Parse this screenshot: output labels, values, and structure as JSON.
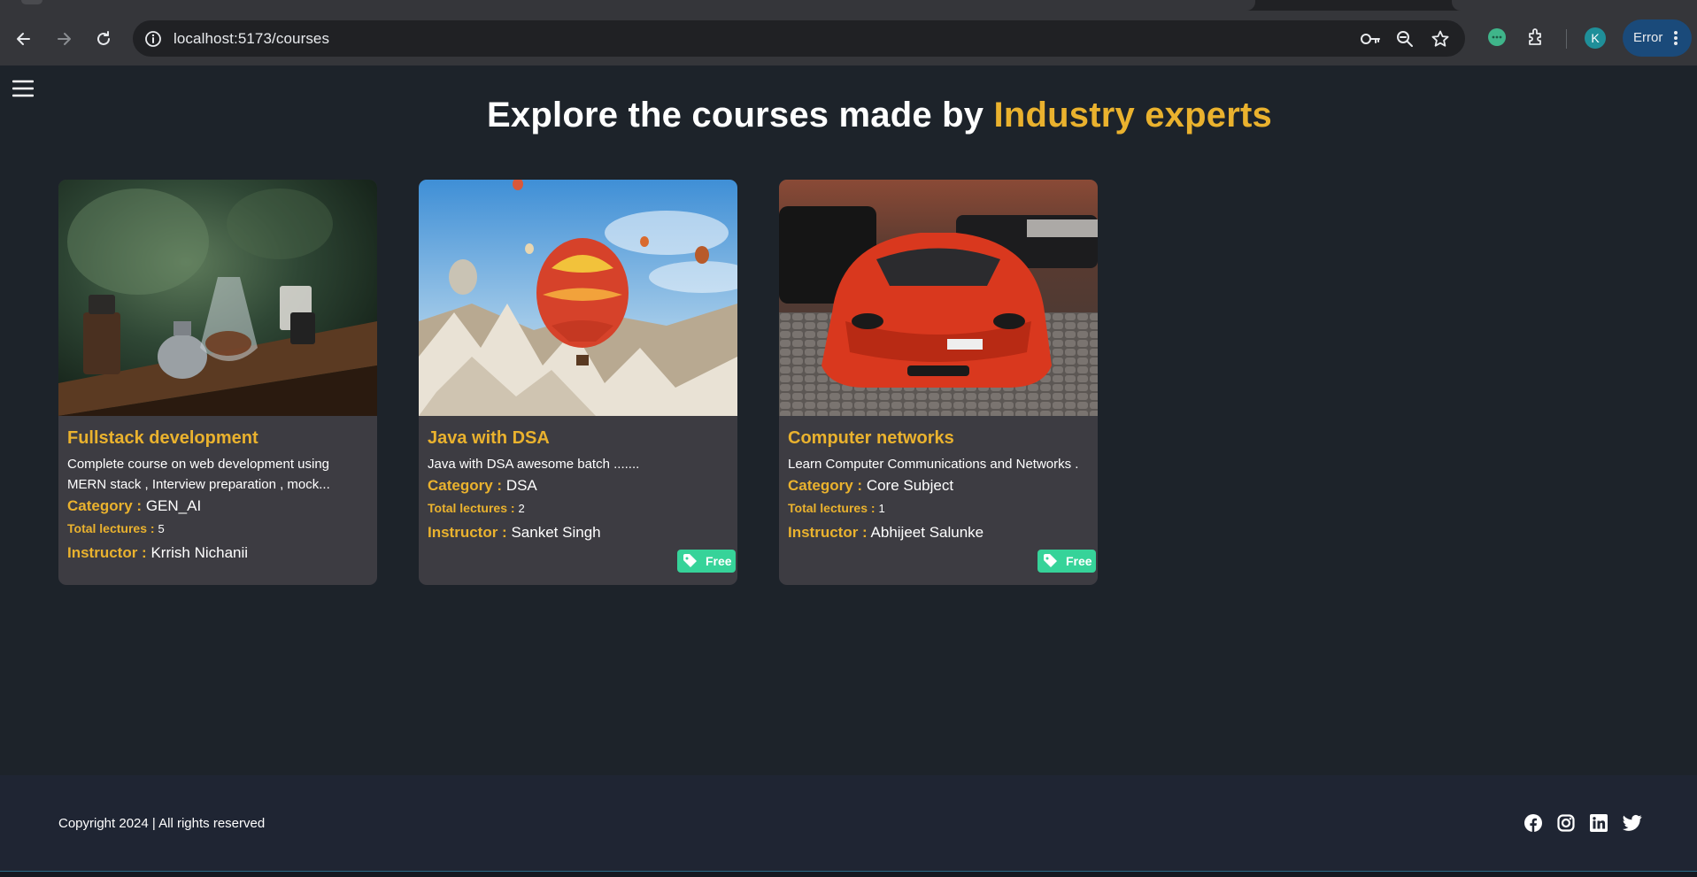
{
  "browser": {
    "url": "localhost:5173/courses",
    "profile_initial": "K",
    "error_label": "Error"
  },
  "page": {
    "title_prefix": "Explore the courses made by ",
    "title_accent": "Industry experts"
  },
  "courses": [
    {
      "title": "Fullstack development",
      "description": "Complete course on web development using MERN stack , Interview preparation , mock...",
      "category_label": "Category :",
      "category": "GEN_AI",
      "lectures_label": "Total lectures :",
      "lectures": "5",
      "instructor_label": "Instructor :",
      "instructor": "Krrish Nichanii",
      "badge": ""
    },
    {
      "title": "Java with DSA",
      "description": "Java with DSA awesome batch .......",
      "category_label": "Category :",
      "category": "DSA",
      "lectures_label": "Total lectures :",
      "lectures": "2",
      "instructor_label": "Instructor :",
      "instructor": "Sanket Singh",
      "badge": "Free"
    },
    {
      "title": "Computer networks",
      "description": "Learn Computer Communications and Networks .",
      "category_label": "Category :",
      "category": "Core Subject",
      "lectures_label": "Total lectures :",
      "lectures": "1",
      "instructor_label": "Instructor :",
      "instructor": "Abhijeet Salunke",
      "badge": "Free"
    }
  ],
  "footer": {
    "copyright": "Copyright 2024 | All rights reserved",
    "social": [
      "facebook-icon",
      "instagram-icon",
      "linkedin-icon",
      "twitter-icon"
    ]
  },
  "colors": {
    "page_bg": "#1d232a",
    "card_bg": "#3d3c42",
    "accent": "#eab22e",
    "badge": "#36d399",
    "footer_bg": "#1f2533"
  }
}
